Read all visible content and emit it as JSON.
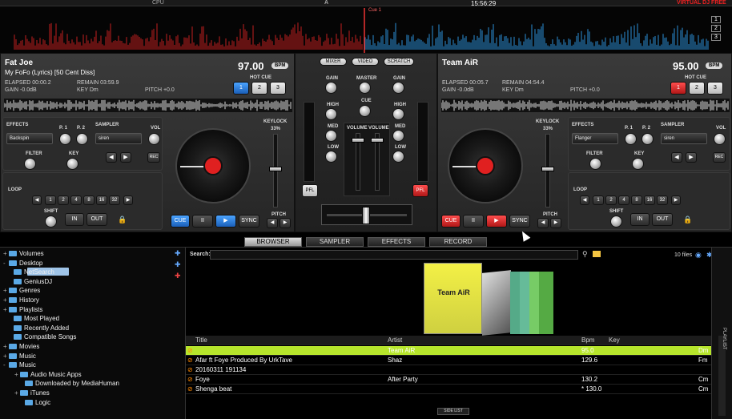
{
  "top": {
    "cpu_label": "CPU",
    "clock": "15:56:29",
    "brand": "VIRTUAL DJ FREE",
    "cue_marker": "Cue 1",
    "deck_nums": [
      "1",
      "2",
      "3"
    ],
    "a_label": "A"
  },
  "deckL": {
    "artist": "Fat Joe",
    "title": "My FoFo (Lyrics) [50 Cent Diss]",
    "bpm": "97.00",
    "bpm_label": "BPM",
    "elapsed": "ELAPSED 00:00.2",
    "remain": "REMAIN 03:59.9",
    "gain": "GAIN -0.0dB",
    "key": "KEY Dm",
    "pitch": "PITCH +0.0",
    "hot_cue": "HOT CUE",
    "hot_cue_btns": [
      "1",
      "2",
      "3"
    ],
    "effects_label": "EFFECTS",
    "effect_value": "Backspin",
    "p1": "P. 1",
    "p2": "P. 2",
    "sampler_label": "SAMPLER",
    "sampler_value": "siren",
    "vol": "VOL",
    "rec": "REC",
    "filter": "FILTER",
    "key_knob": "KEY",
    "keylock": "KEYLOCK",
    "pitch_pct": "33%",
    "loop": "LOOP",
    "loop_btns": [
      "1",
      "2",
      "4",
      "8",
      "16",
      "32"
    ],
    "shift": "SHIFT",
    "in": "IN",
    "out": "OUT",
    "cue": "CUE",
    "pause": "II",
    "play": "▶",
    "sync": "SYNC",
    "pitch_lbl": "PITCH"
  },
  "deckR": {
    "artist": "Team AiR",
    "bpm": "95.00",
    "bpm_label": "BPM",
    "elapsed": "ELAPSED 00:05.7",
    "remain": "REMAIN 04:54.4",
    "gain": "GAIN -0.0dB",
    "key": "KEY Dm",
    "pitch": "PITCH +0.0",
    "hot_cue": "HOT CUE",
    "hot_cue_btns": [
      "1",
      "2",
      "3"
    ],
    "effects_label": "EFFECTS",
    "effect_value": "Flanger",
    "p1": "P. 1",
    "p2": "P. 2",
    "sampler_label": "SAMPLER",
    "sampler_value": "siren",
    "vol": "VOL",
    "rec": "REC",
    "filter": "FILTER",
    "key_knob": "KEY",
    "keylock": "KEYLOCK",
    "pitch_pct": "33%",
    "loop": "LOOP",
    "loop_btns": [
      "1",
      "2",
      "4",
      "8",
      "16",
      "32"
    ],
    "shift": "SHIFT",
    "in": "IN",
    "out": "OUT",
    "cue": "CUE",
    "pause": "II",
    "play": "▶",
    "sync": "SYNC",
    "pitch_lbl": "PITCH"
  },
  "mixer": {
    "tabs": [
      "MIXER",
      "VIDEO",
      "SCRATCH"
    ],
    "gain": "GAIN",
    "master": "MASTER",
    "cue": "CUE",
    "high": "HIGH",
    "med": "MED",
    "low": "LOW",
    "volume": "VOLUME",
    "pfl": "PFL"
  },
  "tabs": [
    "BROWSER",
    "SAMPLER",
    "EFFECTS",
    "RECORD"
  ],
  "browser": {
    "search_label": "Search:",
    "files_count": "10 files",
    "tree": [
      {
        "label": "Volumes",
        "exp": "+"
      },
      {
        "label": "Desktop",
        "exp": "-"
      },
      {
        "label": "NetSearch",
        "exp": ""
      },
      {
        "label": "GeniusDJ",
        "exp": ""
      },
      {
        "label": "Genres",
        "exp": "+"
      },
      {
        "label": "History",
        "exp": "+"
      },
      {
        "label": "Playlists",
        "exp": "+"
      },
      {
        "label": "Most Played",
        "exp": ""
      },
      {
        "label": "Recently Added",
        "exp": ""
      },
      {
        "label": "Compatible Songs",
        "exp": ""
      },
      {
        "label": "Movies",
        "exp": "+"
      },
      {
        "label": "Music",
        "exp": "+"
      },
      {
        "label": "Music",
        "exp": "-"
      },
      {
        "label": "Audio Music Apps",
        "exp": "+"
      },
      {
        "label": "Downloaded by MediaHuman",
        "exp": ""
      },
      {
        "label": "iTunes",
        "exp": "+"
      },
      {
        "label": "Logic",
        "exp": ""
      }
    ],
    "cover_text": "Team AiR",
    "columns": [
      "Title",
      "Artist",
      "Bpm",
      "Key"
    ],
    "rows": [
      {
        "title": "",
        "artist": "Team AiR",
        "bpm": "95.0",
        "key": "Dm"
      },
      {
        "title": "Afar ft Foye Produced By UrkTave",
        "artist": "Shaz",
        "bpm": "129.6",
        "key": "Fm"
      },
      {
        "title": "20160311 191134",
        "artist": "",
        "bpm": "",
        "key": ""
      },
      {
        "title": "Foye",
        "artist": "After Party",
        "bpm": "130.2",
        "key": "Cm"
      },
      {
        "title": "Shenga beat",
        "artist": "",
        "bpm": "* 130.0",
        "key": "Cm"
      }
    ],
    "side_list": "SIDE LIST",
    "playlist": "PLAYLIST"
  }
}
